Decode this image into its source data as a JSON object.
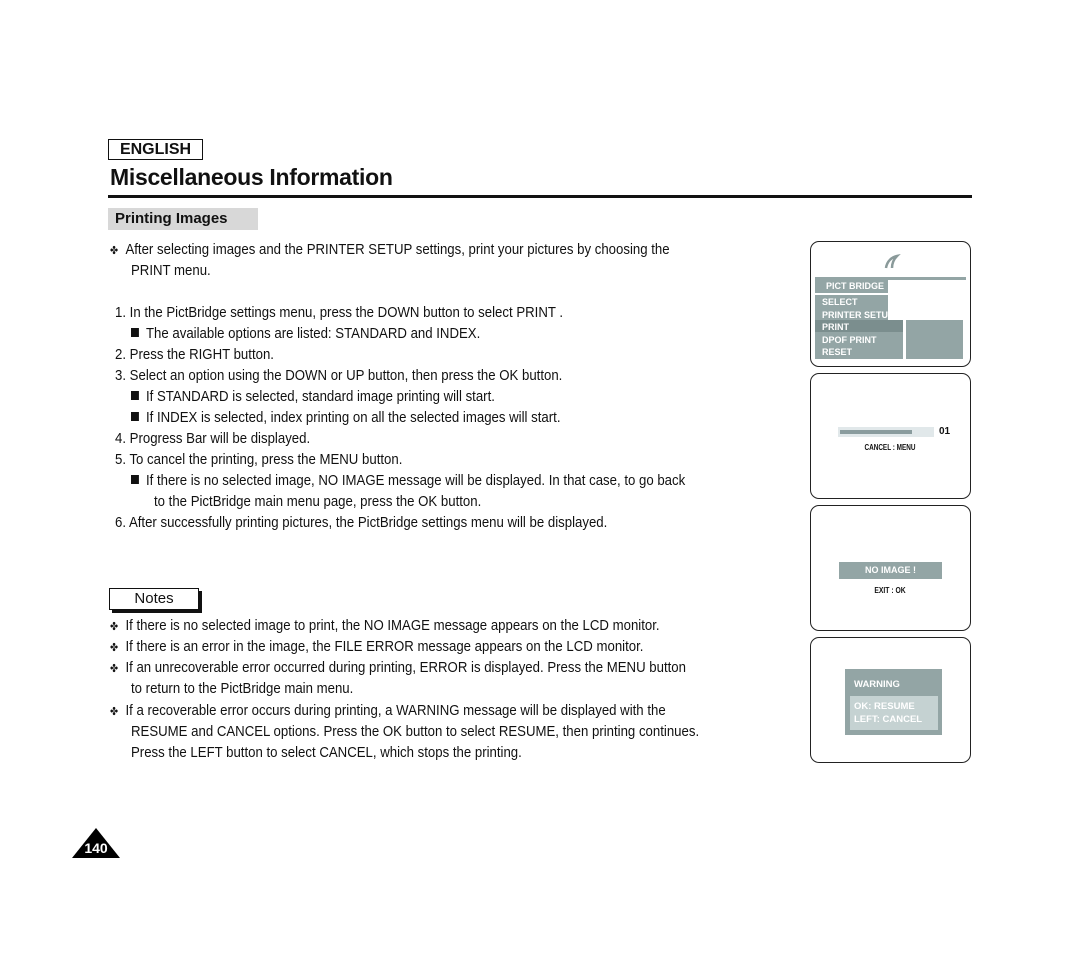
{
  "header": {
    "language": "ENGLISH",
    "title": "Miscellaneous Information",
    "section": "Printing Images"
  },
  "intro": {
    "line1": "After selecting images and the PRINTER SETUP settings, print your pictures by choosing the",
    "line2": "PRINT menu."
  },
  "steps": {
    "s1": "1.  In the PictBridge settings menu, press the DOWN button to select  PRINT .",
    "s1a": "The available options are listed: STANDARD and INDEX.",
    "s2": "2.  Press the RIGHT button.",
    "s3": "3.  Select an option using the DOWN or UP button, then press the OK button.",
    "s3a": "If  STANDARD  is selected, standard image printing will start.",
    "s3b": "If  INDEX  is selected, index printing on all the selected images will start.",
    "s4": "4.  Progress Bar will be displayed.",
    "s5": "5.  To cancel the printing, press the MENU button.",
    "s5a1": "If there is no selected image,  NO IMAGE  message will be displayed. In that case, to go back",
    "s5a2": "to the PictBridge main menu page, press the OK button.",
    "s6": "6.  After successfully printing pictures, the PictBridge settings menu will be displayed."
  },
  "notes": {
    "label": "Notes",
    "n1": "If there is no selected image to print, the  NO IMAGE  message appears on the LCD monitor.",
    "n2": "If there is an error in the image, the  FILE ERROR  message appears on the LCD monitor.",
    "n3a": "If an unrecoverable error occurred during printing,  ERROR  is displayed. Press the MENU button",
    "n3b": "to return to the PictBridge main menu.",
    "n4a": "If a recoverable error occurs during printing, a  WARNING  message will be displayed with the",
    "n4b": "RESUME and CANCEL options. Press the OK button to select RESUME, then printing continues.",
    "n4c": "Press the LEFT button to select CANCEL, which stops the printing."
  },
  "bullet_glyph": "✤",
  "page_number": "140",
  "screens": {
    "menu": {
      "title": "PICT BRIDGE",
      "items": [
        "SELECT",
        "PRINTER SETU",
        "PRINT",
        "DPOF PRINT",
        "RESET"
      ],
      "selected": "PRINT"
    },
    "progress": {
      "count": "01",
      "hint": "CANCEL : MENU",
      "progress_fraction": 0.78
    },
    "noimage": {
      "message": "NO IMAGE !",
      "hint": "EXIT : OK"
    },
    "warning": {
      "title": "WARNING",
      "option1": "OK: RESUME",
      "option2": "LEFT: CANCEL"
    }
  },
  "colors": {
    "lcd_panel": "#93a5a5",
    "lcd_dark": "#7b8e8e",
    "lcd_light": "#c5d2d2"
  }
}
